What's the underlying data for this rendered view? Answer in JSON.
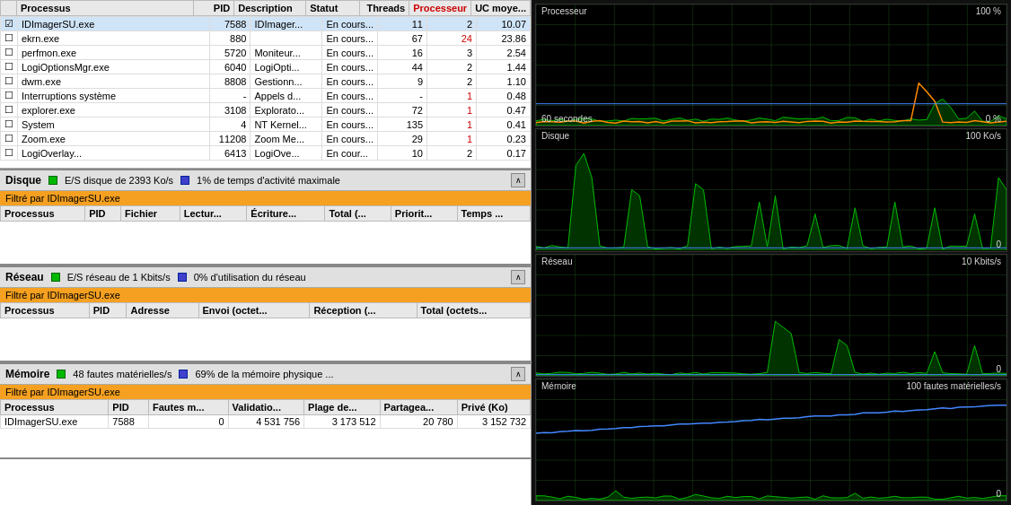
{
  "processTable": {
    "columns": [
      "",
      "Processus",
      "PID",
      "Description",
      "Statut",
      "Threads",
      "Processeur",
      "UC moye..."
    ],
    "rows": [
      {
        "checked": true,
        "name": "IDImagerSU.exe",
        "pid": "7588",
        "desc": "IDImager...",
        "status": "En cours...",
        "threads": "11",
        "proc": "2",
        "uc": "10.07",
        "procHighlight": false
      },
      {
        "checked": false,
        "name": "ekrn.exe",
        "pid": "880",
        "desc": "",
        "status": "En cours...",
        "threads": "67",
        "proc": "24",
        "uc": "23.86",
        "procHighlight": true
      },
      {
        "checked": false,
        "name": "perfmon.exe",
        "pid": "5720",
        "desc": "Moniteur...",
        "status": "En cours...",
        "threads": "16",
        "proc": "3",
        "uc": "2.54",
        "procHighlight": false
      },
      {
        "checked": false,
        "name": "LogiOptionsMgr.exe",
        "pid": "6040",
        "desc": "LogiOpti...",
        "status": "En cours...",
        "threads": "44",
        "proc": "2",
        "uc": "1.44",
        "procHighlight": false
      },
      {
        "checked": false,
        "name": "dwm.exe",
        "pid": "8808",
        "desc": "Gestionn...",
        "status": "En cours...",
        "threads": "9",
        "proc": "2",
        "uc": "1.10",
        "procHighlight": false
      },
      {
        "checked": false,
        "name": "Interruptions système",
        "pid": "-",
        "desc": "Appels d...",
        "status": "En cours...",
        "threads": "-",
        "proc": "1",
        "uc": "0.48",
        "procHighlight": true
      },
      {
        "checked": false,
        "name": "explorer.exe",
        "pid": "3108",
        "desc": "Explorato...",
        "status": "En cours...",
        "threads": "72",
        "proc": "1",
        "uc": "0.47",
        "procHighlight": true
      },
      {
        "checked": false,
        "name": "System",
        "pid": "4",
        "desc": "NT Kernel...",
        "status": "En cours...",
        "threads": "135",
        "proc": "1",
        "uc": "0.41",
        "procHighlight": true
      },
      {
        "checked": false,
        "name": "Zoom.exe",
        "pid": "11208",
        "desc": "Zoom Me...",
        "status": "En cours...",
        "threads": "29",
        "proc": "1",
        "uc": "0.23",
        "procHighlight": true
      },
      {
        "checked": false,
        "name": "LogiOverlay...",
        "pid": "6413",
        "desc": "LogiOve...",
        "status": "En cour...",
        "threads": "10",
        "proc": "2",
        "uc": "0.17",
        "procHighlight": false
      }
    ]
  },
  "diskSection": {
    "title": "Disque",
    "stat1": "E/S disque de 2393 Ko/s",
    "stat2": "1% de temps d'activité maximale",
    "filterLabel": "Filtré par IDImagerSU.exe",
    "columns": [
      "Processus",
      "PID",
      "Fichier",
      "Lectur...",
      "Écriture...",
      "Total (...",
      "Priorit...",
      "Temps ..."
    ],
    "rows": []
  },
  "networkSection": {
    "title": "Réseau",
    "stat1": "E/S réseau de 1 Kbits/s",
    "stat2": "0% d'utilisation du réseau",
    "filterLabel": "Filtré par IDImagerSU.exe",
    "columns": [
      "Processus",
      "PID",
      "Adresse",
      "Envoi (octet...",
      "Réception (... ",
      "Total (octets..."
    ],
    "rows": []
  },
  "memorySection": {
    "title": "Mémoire",
    "stat1": "48 fautes matérielles/s",
    "stat2": "69% de la mémoire physique ...",
    "filterLabel": "Filtré par IDImagerSU.exe",
    "columns": [
      "Processus",
      "PID",
      "Fautes m...",
      "Validatio...",
      "Plage de...",
      "Partagea...",
      "Privé (Ko)"
    ],
    "rows": [
      {
        "name": "IDImagerSU.exe",
        "pid": "7588",
        "faults": "0",
        "validation": "4 531 756",
        "plage": "3 173 512",
        "shared": "20 780",
        "prive": "3 152 732"
      }
    ]
  },
  "charts": {
    "cpu": {
      "title": "Processeur",
      "max": "100 %",
      "min": "0 %",
      "timeLabel": "60 secondes"
    },
    "disk": {
      "title": "Disque",
      "max": "100 Ko/s",
      "min": "0"
    },
    "network": {
      "title": "Réseau",
      "max": "10 Kbits/s",
      "min": "0"
    },
    "memory": {
      "title": "Mémoire",
      "max": "100 fautes matérielles/s",
      "min": "0"
    }
  }
}
